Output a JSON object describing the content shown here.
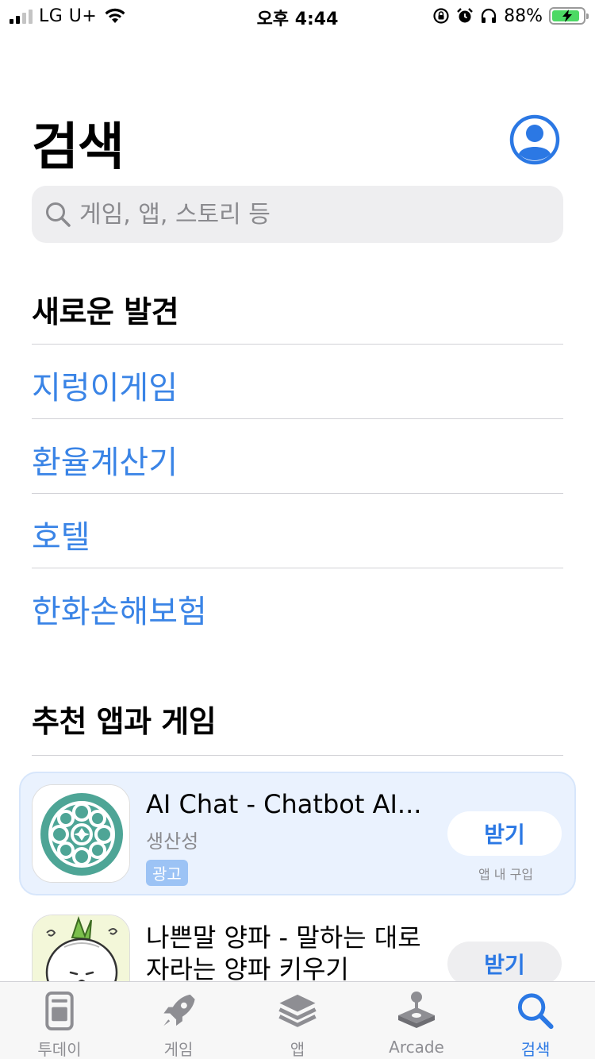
{
  "status_bar": {
    "carrier": "LG U+",
    "time": "오후 4:44",
    "battery": "88%"
  },
  "header": {
    "title": "검색"
  },
  "search": {
    "placeholder": "게임, 앱, 스토리 등"
  },
  "discover": {
    "title": "새로운 발견",
    "items": [
      "지렁이게임",
      "환율계산기",
      "호텔",
      "한화손해보험"
    ]
  },
  "recommended": {
    "title": "추천 앱과 게임",
    "apps": [
      {
        "name": "AI Chat - Chatbot AI...",
        "category": "생산성",
        "badge": "광고",
        "button": "받기",
        "note": "앱 내 구입",
        "icon": "mandala-icon"
      },
      {
        "name_line1": "나쁜말 양파 - 말하는 대로",
        "name_line2": "자라는 양파 키우기",
        "button": "받기",
        "icon": "onion-character-icon"
      }
    ]
  },
  "tab_bar": {
    "tabs": [
      "투데이",
      "게임",
      "앱",
      "Arcade",
      "검색"
    ],
    "active": "검색"
  },
  "colors": {
    "accent": "#3a84e6",
    "ad_card": "#eaf2fe",
    "search_bg": "#eeeef0"
  }
}
